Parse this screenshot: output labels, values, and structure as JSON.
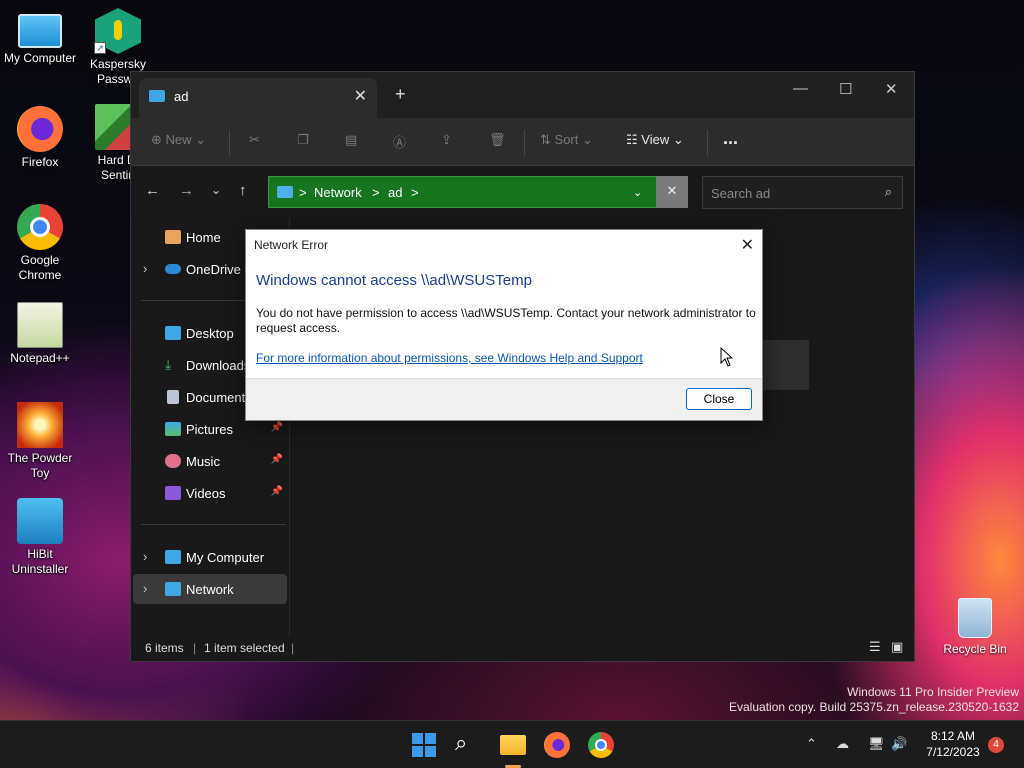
{
  "desktop": {
    "icons": [
      {
        "label": "My Computer"
      },
      {
        "label": "Kaspersky Passwo"
      },
      {
        "label": "Firefox"
      },
      {
        "label": "Hard Di Sentin"
      },
      {
        "label": "Google Chrome"
      },
      {
        "label": "Notepad++"
      },
      {
        "label": "The Powder Toy"
      },
      {
        "label": "HiBit Uninstaller"
      }
    ],
    "recycle_bin": "Recycle Bin",
    "watermark": [
      "Windows 11 Pro Insider Preview",
      "Evaluation copy. Build 25375.zn_release.230520-1632"
    ]
  },
  "explorer": {
    "tab_title": "ad",
    "toolbar": {
      "new": "New",
      "sort": "Sort",
      "view": "View",
      "more": "..."
    },
    "address": {
      "crumbs": [
        "Network",
        "ad"
      ],
      "sep": ">"
    },
    "search_placeholder": "Search ad",
    "nav": {
      "home": "Home",
      "onedrive": "OneDrive",
      "desktop": "Desktop",
      "downloads": "Downloads",
      "documents": "Documents",
      "pictures": "Pictures",
      "music": "Music",
      "videos": "Videos",
      "my_computer": "My Computer",
      "network": "Network"
    },
    "status": {
      "items": "6 items",
      "selected": "1 item selected"
    }
  },
  "dialog": {
    "title": "Network Error",
    "heading": "Windows cannot access \\\\ad\\WSUSTemp",
    "message": "You do not have permission to access \\\\ad\\WSUSTemp. Contact your network administrator to request access.",
    "link": "For more information about permissions, see Windows Help and Support",
    "close_button": "Close"
  },
  "taskbar": {
    "time": "8:12 AM",
    "date": "7/12/2023",
    "notification_count": "4",
    "colors": {
      "start": "#3b9bea",
      "explorer": "#f4c542",
      "firefox": "#ff7139",
      "chrome": "#4285f4"
    }
  }
}
